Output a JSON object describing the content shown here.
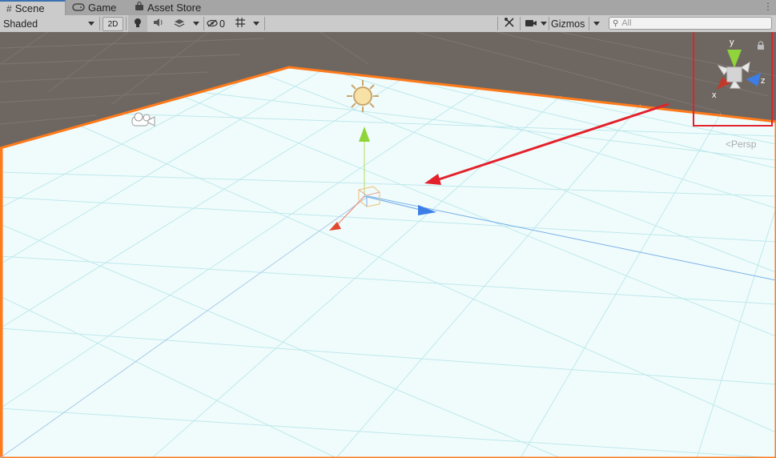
{
  "tabs": [
    {
      "label": "Scene",
      "icon": "grid-icon",
      "active": true
    },
    {
      "label": "Game",
      "icon": "gamepad-icon",
      "active": false
    },
    {
      "label": "Asset Store",
      "icon": "shopping-bag-icon",
      "active": false
    }
  ],
  "toolbar": {
    "draw_mode": "Shaded",
    "mode_2d": "2D",
    "hidden_count": "0",
    "gizmos_label": "Gizmos",
    "search_placeholder": "All"
  },
  "gizmo": {
    "y_label": "y",
    "z_label": "z",
    "x_label": "x",
    "persp_label": "Persp"
  },
  "colors": {
    "ground_plane": "#f0fcfc",
    "sky_dark": "#6e6761",
    "selection_outline": "#ff7a1a",
    "annotation": "#e3212b",
    "axis_x": "#e24a2f",
    "axis_y": "#8fd43a",
    "axis_z": "#3d7de6"
  }
}
